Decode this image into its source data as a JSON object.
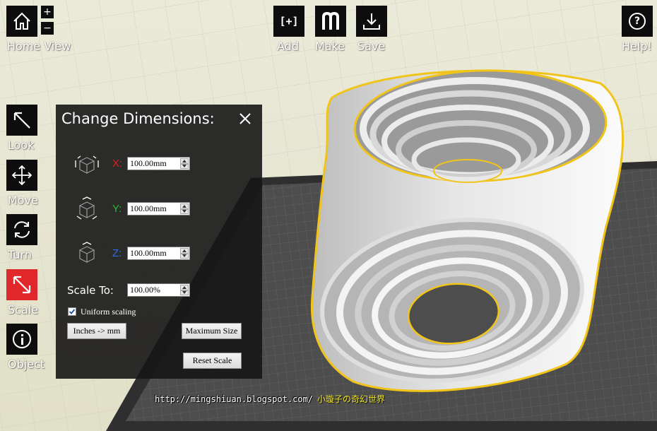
{
  "toolbar_top": {
    "home": {
      "label": "Home View",
      "icon": "home-icon"
    },
    "zoom_in": "+",
    "zoom_out": "−",
    "add": {
      "label": "Add",
      "glyph": "[+]"
    },
    "make": {
      "label": "Make",
      "icon": "makerbot-m-icon"
    },
    "save": {
      "label": "Save",
      "icon": "download-icon"
    },
    "help": {
      "label": "Help!",
      "glyph": "?"
    }
  },
  "toolbar_left": [
    {
      "label": "Look",
      "icon": "look-arrow-icon",
      "active": false
    },
    {
      "label": "Move",
      "icon": "move-arrows-icon",
      "active": false
    },
    {
      "label": "Turn",
      "icon": "rotate-icon",
      "active": false
    },
    {
      "label": "Scale",
      "icon": "scale-arrow-icon",
      "active": true
    },
    {
      "label": "Object",
      "icon": "info-icon",
      "active": false
    }
  ],
  "dimensions_panel": {
    "title": "Change Dimensions:",
    "close_glyph": "×",
    "x": {
      "axis": "X:",
      "value": "100.00mm",
      "color": "#e02020"
    },
    "y": {
      "axis": "Y:",
      "value": "100.00mm",
      "color": "#2eb82e"
    },
    "z": {
      "axis": "Z:",
      "value": "100.00mm",
      "color": "#2f6fe0"
    },
    "scale_label": "Scale To:",
    "scale_value": "100.00%",
    "uniform_label": "Uniform scaling",
    "uniform_checked": true,
    "inches_button": "Inches -> mm",
    "max_size_button": "Maximum Size",
    "reset_button": "Reset Scale"
  },
  "watermark": {
    "url": "http://mingshiuan.blogspot.com/",
    "blog": "小璇子の奇幻世界"
  },
  "colors": {
    "background": "#e7e6d0",
    "build_plate": "#4d4d4d",
    "selection_outline": "#f0c419",
    "active_tool": "#e0282b",
    "toolbar_button": "#0d0d0d"
  }
}
